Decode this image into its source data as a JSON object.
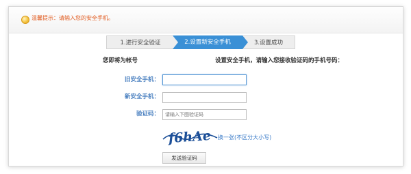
{
  "tip": {
    "text": "温馨提示：请输入您的安全手机。"
  },
  "steps": [
    {
      "label": "1.进行安全验证"
    },
    {
      "label": "2.设置新安全手机"
    },
    {
      "label": "3.设置成功"
    }
  ],
  "form": {
    "account_label": "您即将为帐号",
    "instruction": "设置安全手机，请输入您接收验证码的手机号码：",
    "old_phone_label": "旧安全手机：",
    "old_phone_value": "",
    "new_phone_label": "新安全手机：",
    "new_phone_value": "",
    "code_label": "验证码：",
    "code_placeholder": "请输入下图验证码",
    "captcha_text": "f6hAe",
    "captcha_refresh": "换一张(不区分大小写)",
    "send_button": "发送验证码"
  },
  "colors": {
    "active_step": "#3a90d6",
    "label_blue": "#4a80c0",
    "tip_orange": "#e15a1e",
    "link_blue": "#3a7bc8",
    "captcha_blue": "#1c4f98"
  }
}
